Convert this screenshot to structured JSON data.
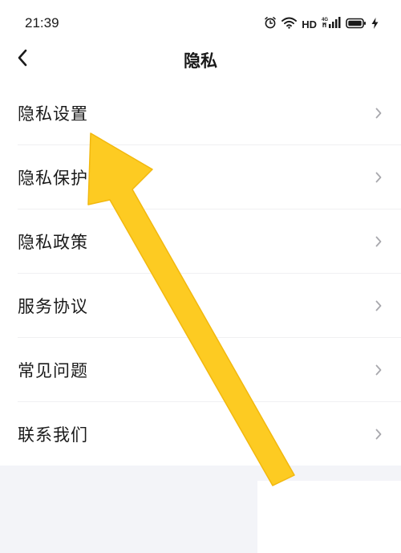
{
  "status_bar": {
    "time": "21:39",
    "network_label": "HD",
    "signal_tag": "4G",
    "icons": [
      "alarm-icon",
      "wifi-icon",
      "signal-icon",
      "battery-icon",
      "charging-icon"
    ]
  },
  "header": {
    "title": "隐私",
    "back_icon": "chevron-left-icon"
  },
  "menu": {
    "items": [
      {
        "label": "隐私设置"
      },
      {
        "label": "隐私保护"
      },
      {
        "label": "隐私政策"
      },
      {
        "label": "服务协议"
      },
      {
        "label": "常见问题"
      },
      {
        "label": "联系我们"
      }
    ],
    "chevron_icon": "chevron-right-icon"
  },
  "annotation": {
    "icon": "pointer-arrow-icon",
    "color": "#FDCB22",
    "target": "隐私设置"
  }
}
